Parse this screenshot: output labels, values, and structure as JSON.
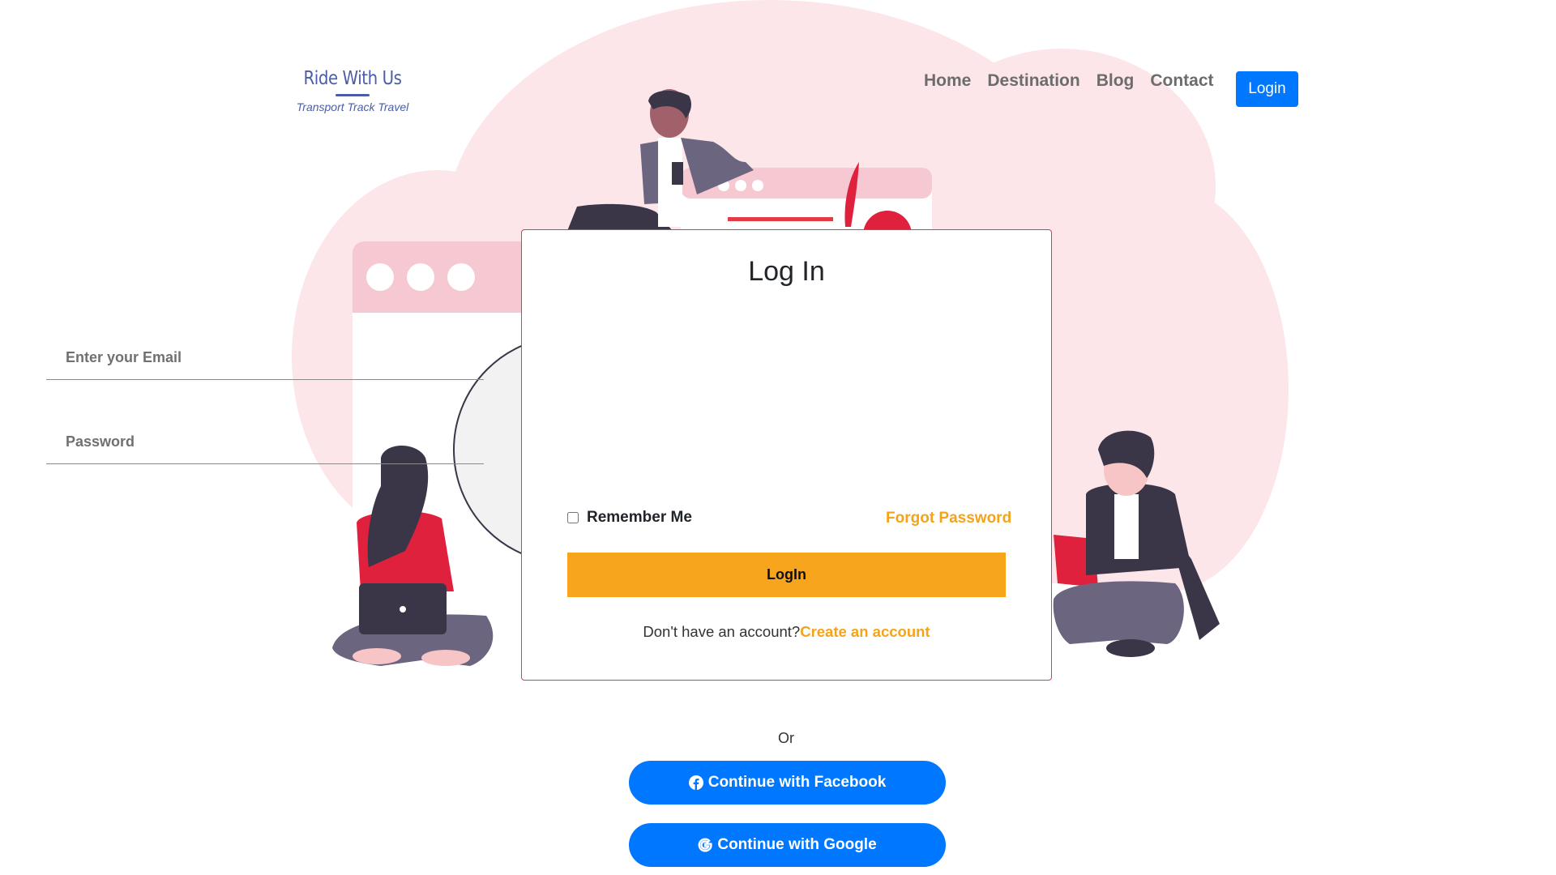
{
  "brand": {
    "name": "Ride With Us",
    "tagline": "Transport Track Travel"
  },
  "nav": {
    "links": [
      "Home",
      "Destination",
      "Blog",
      "Contact"
    ],
    "login_label": "Login"
  },
  "login_form": {
    "title": "Log In",
    "email_placeholder": "Enter your Email",
    "password_placeholder": "Password",
    "remember_label": "Remember Me",
    "remember_checked": false,
    "forgot_label": "Forgot Password",
    "submit_label": "LogIn",
    "signup_prompt": "Don't have an account?",
    "signup_link": "Create an account"
  },
  "alt_login": {
    "or_label": "Or",
    "facebook_label": "Continue with Facebook",
    "facebook_icon": "facebook-icon",
    "google_label": "Continue with Google",
    "google_icon": "google-icon"
  },
  "colors": {
    "primary": "#0077ff",
    "accent": "#f6a51d",
    "card_border": "#e53945",
    "cloud": "#fce6ea",
    "brand": "#4a5ea8"
  }
}
